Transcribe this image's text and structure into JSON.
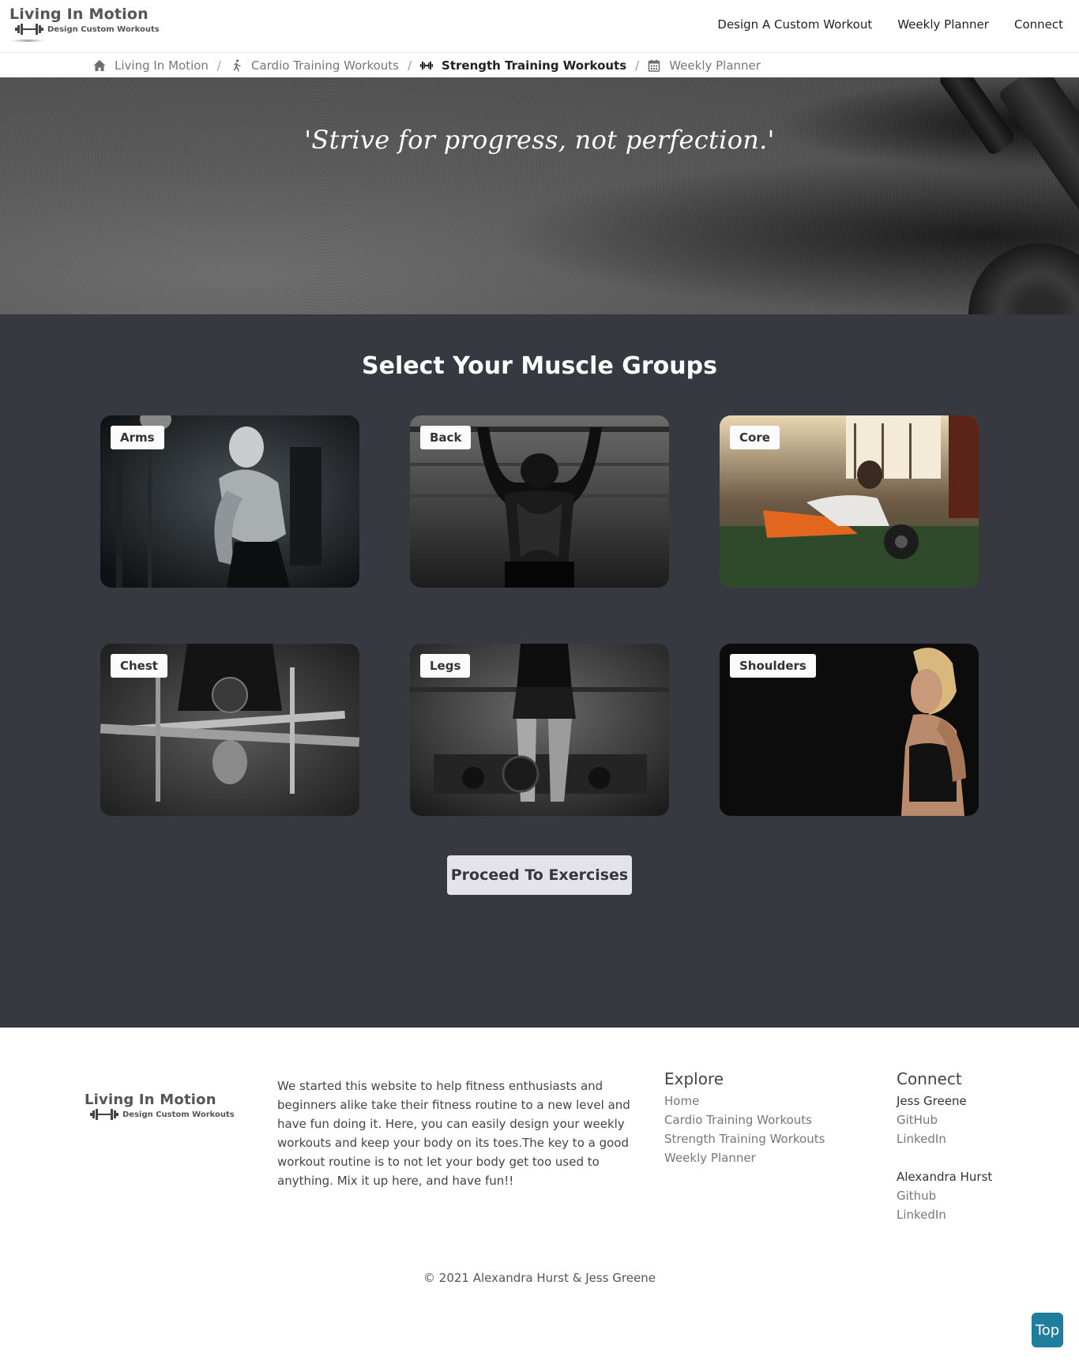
{
  "brand": {
    "title": "Living In Motion",
    "subtitle": "Design Custom Workouts"
  },
  "nav": {
    "items": [
      "Design A Custom Workout",
      "Weekly Planner",
      "Connect"
    ]
  },
  "breadcrumb": [
    {
      "label": "Living In Motion",
      "icon": "home-icon"
    },
    {
      "label": "Cardio Training Workouts",
      "icon": "running-icon"
    },
    {
      "label": "Strength Training Workouts",
      "icon": "dumbbell-icon",
      "active": true
    },
    {
      "label": "Weekly Planner",
      "icon": "calendar-icon"
    }
  ],
  "hero": {
    "quote": "'Strive for progress, not perfection.'"
  },
  "muscle": {
    "heading": "Select Your Muscle Groups",
    "cards": [
      "Arms",
      "Back",
      "Core",
      "Chest",
      "Legs",
      "Shoulders"
    ],
    "proceed_label": "Proceed To Exercises"
  },
  "footer": {
    "about": "We started this website to help fitness enthusiasts and beginners alike take their fitness routine to a new level and have fun doing it. Here, you can easily design your weekly workouts and keep your body on its toes.The key to a good workout routine is to not let your body get too used to anything. Mix it up here, and have fun!!",
    "explore": {
      "heading": "Explore",
      "links": [
        "Home",
        "Cardio Training Workouts",
        "Strength Training Workouts",
        "Weekly Planner"
      ]
    },
    "connect": {
      "heading": "Connect",
      "person1": {
        "name": "Jess Greene",
        "github": "GitHub",
        "linkedin": "LinkedIn"
      },
      "person2": {
        "name": "Alexandra Hurst",
        "github": "Github",
        "linkedin": "LinkedIn"
      }
    },
    "copyright": "© 2021 Alexandra Hurst & Jess Greene"
  },
  "top_button": "Top",
  "colors": {
    "section_bg": "#363940",
    "top_button": "#1f7e9c",
    "proceed_bg": "#e4e3ec"
  }
}
